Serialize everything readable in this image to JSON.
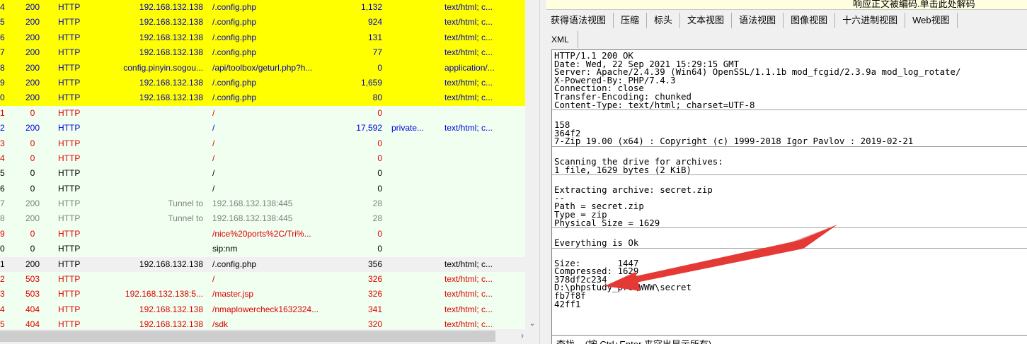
{
  "sessions": [
    {
      "num": "4",
      "result": "200",
      "protocol": "HTTP",
      "host": "192.168.132.138",
      "url": "/.config.php",
      "body": "1,132",
      "caching": "",
      "content_type": "text/html; c...",
      "style": "yellow"
    },
    {
      "num": "5",
      "result": "200",
      "protocol": "HTTP",
      "host": "192.168.132.138",
      "url": "/.config.php",
      "body": "924",
      "caching": "",
      "content_type": "text/html; c...",
      "style": "yellow"
    },
    {
      "num": "6",
      "result": "200",
      "protocol": "HTTP",
      "host": "192.168.132.138",
      "url": "/.config.php",
      "body": "131",
      "caching": "",
      "content_type": "text/html; c...",
      "style": "yellow"
    },
    {
      "num": "7",
      "result": "200",
      "protocol": "HTTP",
      "host": "192.168.132.138",
      "url": "/.config.php",
      "body": "77",
      "caching": "",
      "content_type": "text/html; c...",
      "style": "yellow"
    },
    {
      "num": "8",
      "result": "200",
      "protocol": "HTTP",
      "host": "config.pinyin.sogou...",
      "url": "/api/toolbox/geturl.php?h...",
      "body": "0",
      "caching": "",
      "content_type": "application/...",
      "style": "yellow"
    },
    {
      "num": "9",
      "result": "200",
      "protocol": "HTTP",
      "host": "192.168.132.138",
      "url": "/.config.php",
      "body": "1,659",
      "caching": "",
      "content_type": "text/html; c...",
      "style": "yellow"
    },
    {
      "num": "0",
      "result": "200",
      "protocol": "HTTP",
      "host": "192.168.132.138",
      "url": "/.config.php",
      "body": "80",
      "caching": "",
      "content_type": "text/html; c...",
      "style": "yellow"
    },
    {
      "num": "1",
      "result": "0",
      "protocol": "HTTP",
      "host": "",
      "url": "/",
      "body": "0",
      "caching": "",
      "content_type": "",
      "style": "green red"
    },
    {
      "num": "2",
      "result": "200",
      "protocol": "HTTP",
      "host": "",
      "url": "/",
      "body": "17,592",
      "caching": "private...",
      "content_type": "text/html; c...",
      "style": "green blue"
    },
    {
      "num": "3",
      "result": "0",
      "protocol": "HTTP",
      "host": "",
      "url": "/",
      "body": "0",
      "caching": "",
      "content_type": "",
      "style": "green red"
    },
    {
      "num": "4",
      "result": "0",
      "protocol": "HTTP",
      "host": "",
      "url": "/",
      "body": "0",
      "caching": "",
      "content_type": "",
      "style": "green red"
    },
    {
      "num": "5",
      "result": "0",
      "protocol": "HTTP",
      "host": "",
      "url": "/",
      "body": "0",
      "caching": "",
      "content_type": "",
      "style": "green black"
    },
    {
      "num": "6",
      "result": "0",
      "protocol": "HTTP",
      "host": "",
      "url": "/",
      "body": "0",
      "caching": "",
      "content_type": "",
      "style": "green black"
    },
    {
      "num": "7",
      "result": "200",
      "protocol": "HTTP",
      "host": "Tunnel to",
      "url": "192.168.132.138:445",
      "body": "28",
      "caching": "",
      "content_type": "",
      "style": "green dim"
    },
    {
      "num": "8",
      "result": "200",
      "protocol": "HTTP",
      "host": "Tunnel to",
      "url": "192.168.132.138:445",
      "body": "28",
      "caching": "",
      "content_type": "",
      "style": "green dim"
    },
    {
      "num": "9",
      "result": "0",
      "protocol": "HTTP",
      "host": "",
      "url": "/nice%20ports%2C/Tri%...",
      "body": "0",
      "caching": "",
      "content_type": "",
      "style": "green red"
    },
    {
      "num": "0",
      "result": "0",
      "protocol": "HTTP",
      "host": "",
      "url": "sip:nm",
      "body": "0",
      "caching": "",
      "content_type": "",
      "style": "green black"
    },
    {
      "num": "1",
      "result": "200",
      "protocol": "HTTP",
      "host": "192.168.132.138",
      "url": "/.config.php",
      "body": "356",
      "caching": "",
      "content_type": "text/html; c...",
      "style": "gray"
    },
    {
      "num": "2",
      "result": "503",
      "protocol": "HTTP",
      "host": "",
      "url": "/",
      "body": "326",
      "caching": "",
      "content_type": "text/html; c...",
      "style": "green red"
    },
    {
      "num": "3",
      "result": "503",
      "protocol": "HTTP",
      "host": "192.168.132.138:5...",
      "url": "/master.jsp",
      "body": "326",
      "caching": "",
      "content_type": "text/html; c...",
      "style": "green red"
    },
    {
      "num": "4",
      "result": "404",
      "protocol": "HTTP",
      "host": "192.168.132.138",
      "url": "/nmaplowercheck1632324...",
      "body": "341",
      "caching": "",
      "content_type": "text/html; c...",
      "style": "green red"
    },
    {
      "num": "5",
      "result": "404",
      "protocol": "HTTP",
      "host": "192.168.132.138",
      "url": "/sdk",
      "body": "320",
      "caching": "",
      "content_type": "text/html; c...",
      "style": "green red"
    }
  ],
  "inspector": {
    "banner": "响应正文被编码.单击此处解码",
    "tabs": [
      "获得语法视图",
      "压缩",
      "标头",
      "文本视图",
      "语法视图",
      "图像视图",
      "十六进制视图",
      "Web视图"
    ],
    "tabs2": [
      "XML"
    ],
    "response_blocks": [
      "HTTP/1.1 200 OK\nDate: Wed, 22 Sep 2021 15:29:15 GMT\nServer: Apache/2.4.39 (Win64) OpenSSL/1.1.1b mod_fcgid/2.3.9a mod_log_rotate/\nX-Powered-By: PHP/7.4.3\nConnection: close\nTransfer-Encoding: chunked\nContent-Type: text/html; charset=UTF-8",
      "158\n364f2\n7-Zip 19.00 (x64) : Copyright (c) 1999-2018 Igor Pavlov : 2019-02-21",
      "Scanning the drive for archives:\n1 file, 1629 bytes (2 KiB)",
      "Extracting archive: secret.zip\n--\nPath = secret.zip\nType = zip\nPhysical Size = 1629",
      "Everything is Ok",
      "Size:       1447\nCompressed: 1629\n378df2c234\nD:\\phpstudy_pro\\WWW\\secret\nfb7f8f\n42ff1"
    ],
    "find_placeholder": "查找... (按 Ctrl+Enter 来突出显示所有)"
  },
  "colors": {
    "highlight": "#ffff00",
    "row_green": "#f0fff0",
    "error": "#e00000",
    "link": "#0000c8",
    "annotation": "#e53935"
  },
  "icons": {
    "scroll_down": "chevron-down-icon",
    "scroll_right": "chevron-right-icon"
  }
}
